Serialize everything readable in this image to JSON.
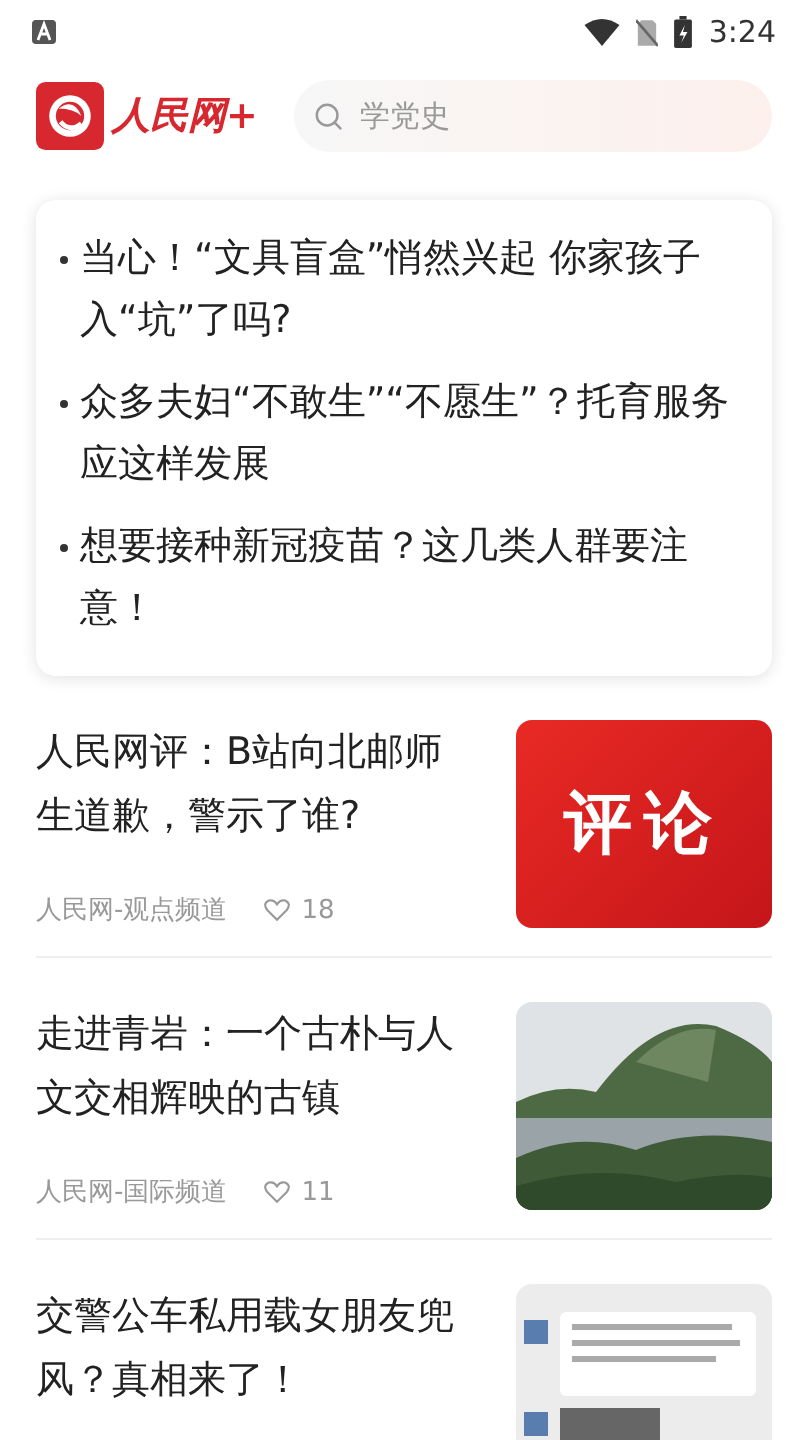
{
  "status_bar": {
    "time": "3:24"
  },
  "header": {
    "logo_text": "人民网+",
    "search": {
      "placeholder": "学党史"
    }
  },
  "headlines": [
    "当心！“文具盲盒”悄然兴起 你家孩子入“坑”了吗?",
    "众多夫妇“不敢生”“不愿生”？托育服务应这样发展",
    "想要接种新冠疫苗？这几类人群要注意！"
  ],
  "articles": [
    {
      "title": "人民网评：B站向北邮师生道歉，警示了谁?",
      "source": "人民网-观点频道",
      "likes": "18",
      "thumb": {
        "kind": "banner",
        "text": "评论"
      }
    },
    {
      "title": "走进青岩：一个古朴与人文交相辉映的古镇",
      "source": "人民网-国际频道",
      "likes": "11"
    },
    {
      "title": "交警公车私用载女朋友兜风？真相来了！",
      "thumb": {
        "kind": "screenshot"
      }
    }
  ]
}
